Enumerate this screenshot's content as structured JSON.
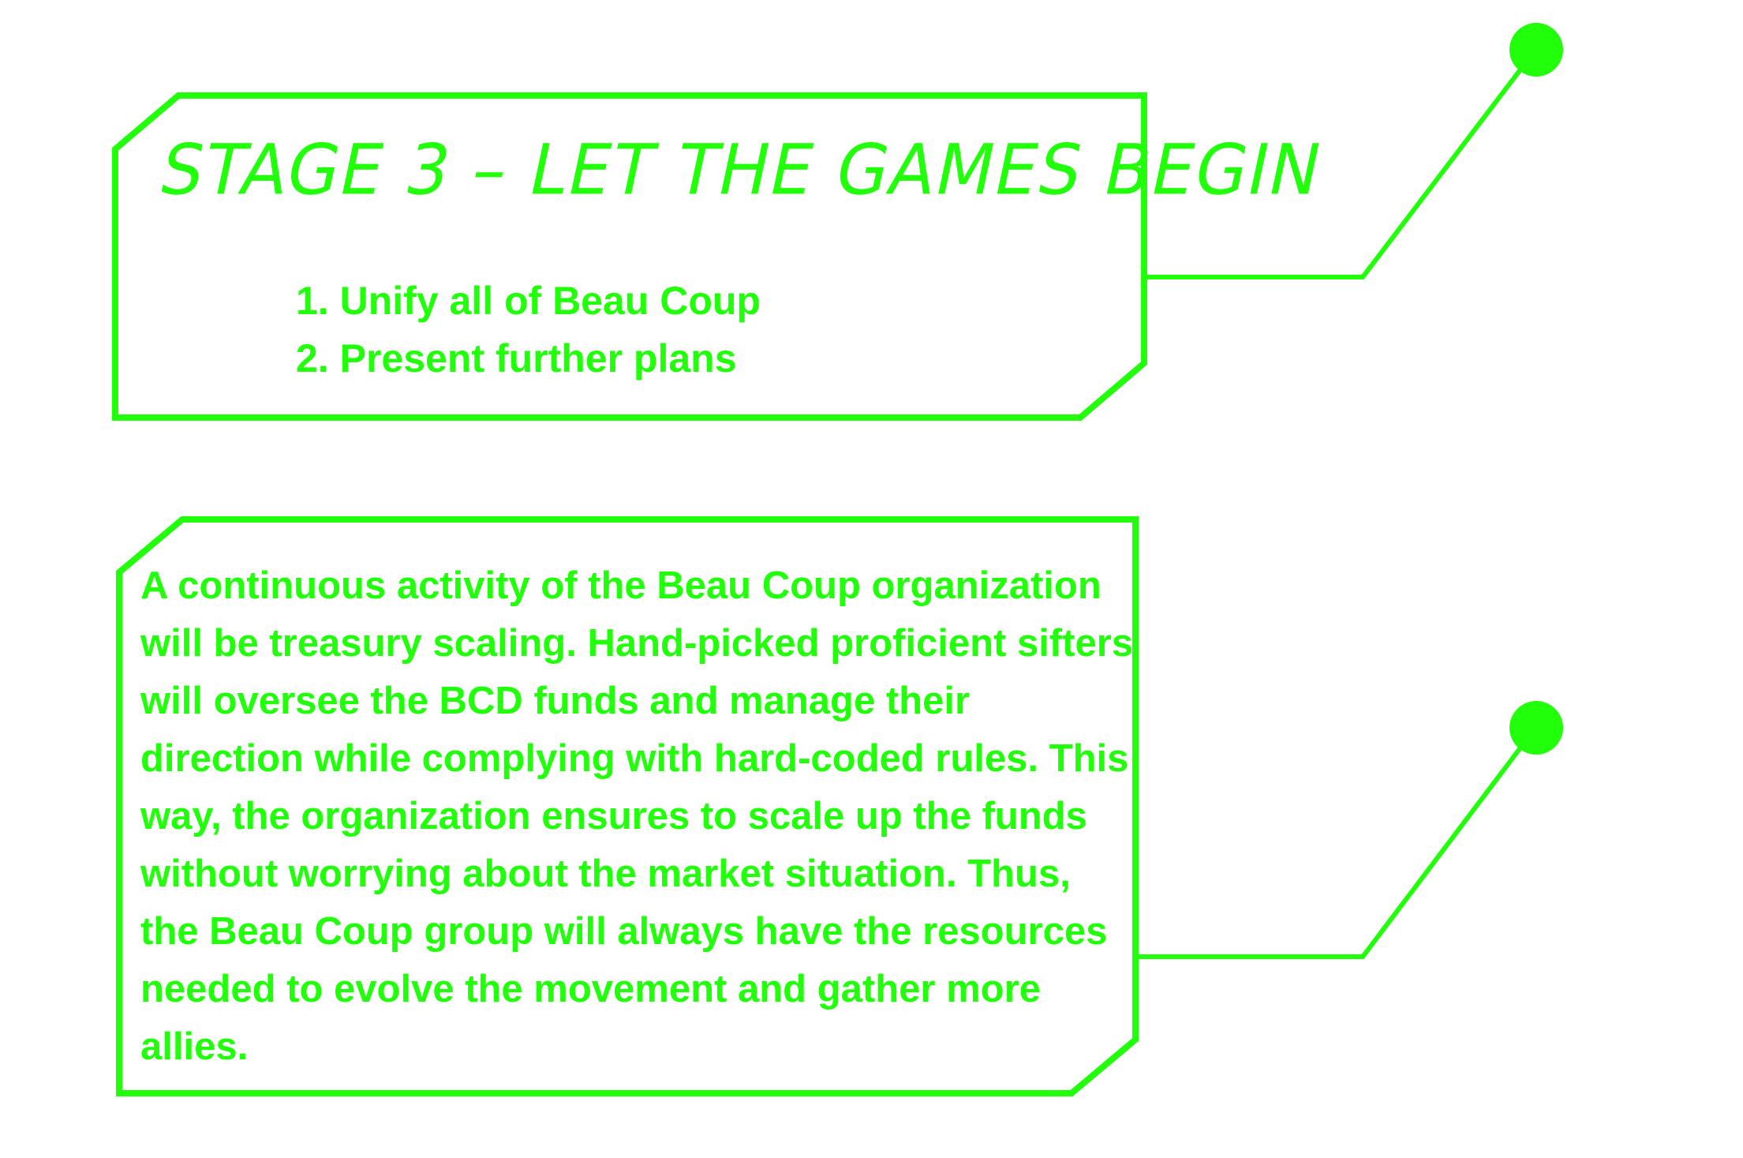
{
  "colors": {
    "accent": "#22ff0a",
    "background": "#ffffff"
  },
  "stage": {
    "title": "STAGE 3 – LET THE GAMES BEGIN",
    "items": [
      {
        "number": "1.",
        "label": "Unify all of Beau Coup"
      },
      {
        "number": "2.",
        "label": "Present further plans"
      }
    ]
  },
  "description": {
    "text": "A continuous activity of the Beau Coup organization will be treasury scaling. Hand-picked proficient sifters will oversee the BCD funds and manage their direction while complying with hard-coded rules. This way, the organization ensures to scale up the funds without worrying about the market situation. Thus, the Beau Coup group will always have the resources needed to evolve the movement and gather more allies."
  }
}
